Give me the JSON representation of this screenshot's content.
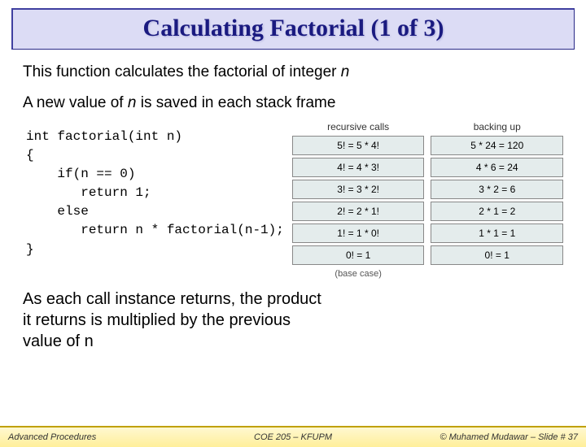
{
  "title": "Calculating Factorial  (1 of 3)",
  "intro1_a": "This function calculates the factorial of integer ",
  "intro1_n": "n",
  "intro2_a": "A new value of ",
  "intro2_n": "n",
  "intro2_b": " is saved in each stack frame",
  "code": "int factorial(int n)\n{\n    if(n == 0)\n       return 1;\n    else\n       return n * factorial(n-1);\n}",
  "diagram": {
    "left_head": "recursive calls",
    "right_head": "backing up",
    "left": [
      "5! = 5 * 4!",
      "4! = 4 * 3!",
      "3! = 3 * 2!",
      "2! = 2 * 1!",
      "1! = 1 * 0!",
      "0! = 1"
    ],
    "right": [
      "5 * 24 = 120",
      "4 * 6 = 24",
      "3 * 2 = 6",
      "2 * 1 = 2",
      "1 * 1 = 1",
      "0! = 1"
    ],
    "base": "(base case)"
  },
  "note_a": "As each call instance returns, the product it returns is multiplied by the previous value of ",
  "note_n": "n",
  "footer": {
    "left": "Advanced Procedures",
    "mid": "COE 205 – KFUPM",
    "right_a": "© Muhamed Mudawar",
    "right_b": " – Slide # 37"
  }
}
